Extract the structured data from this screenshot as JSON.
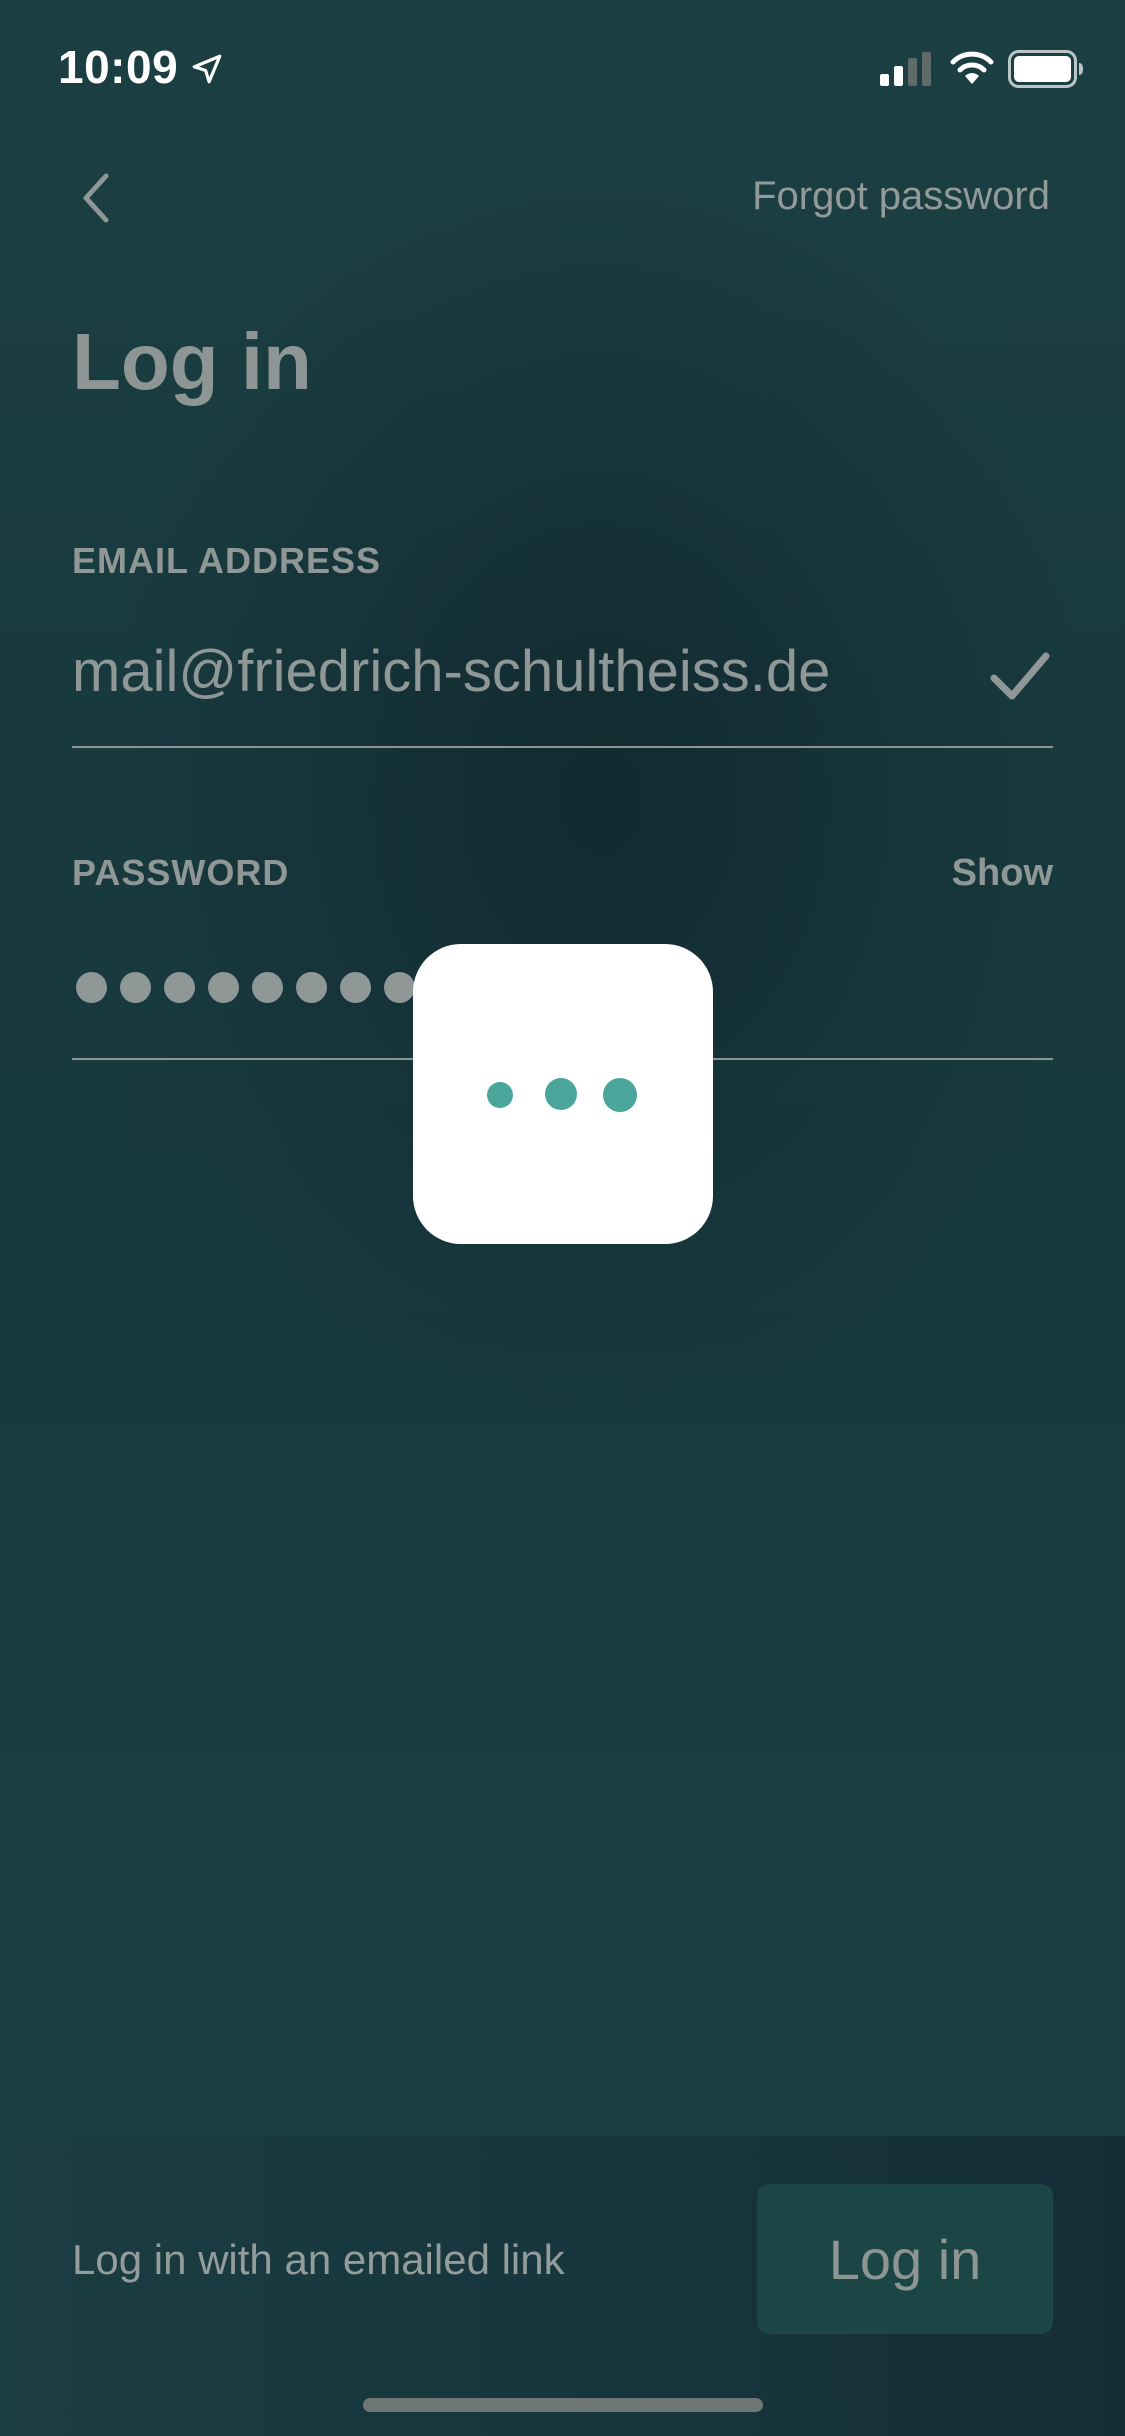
{
  "status_bar": {
    "time": "10:09",
    "icons": [
      "location-arrow-icon",
      "signal-icon",
      "wifi-icon",
      "battery-icon"
    ]
  },
  "nav": {
    "back_icon": "chevron-left-icon",
    "forgot_password": "Forgot password"
  },
  "title": "Log in",
  "email": {
    "label": "EMAIL ADDRESS",
    "value": "mail@friedrich-schultheiss.de",
    "valid_icon": "check-icon"
  },
  "password": {
    "label": "PASSWORD",
    "show_label": "Show",
    "masked_length": 8
  },
  "loading": {
    "icon": "loading-dots-icon",
    "dot_color": "#4aa59a"
  },
  "footer": {
    "email_link_label": "Log in with an emailed link",
    "login_button_label": "Log in"
  },
  "colors": {
    "background": "#183a3f",
    "overlay": "#ffffff",
    "accent": "#4aa59a"
  }
}
